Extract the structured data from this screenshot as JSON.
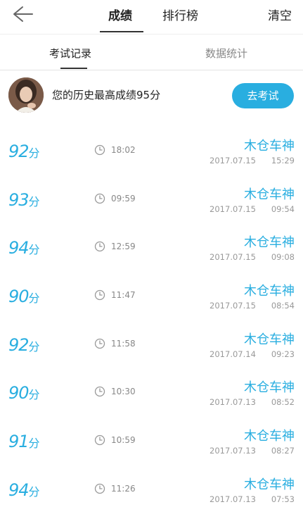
{
  "header": {
    "tabs": [
      {
        "label": "成绩",
        "active": true
      },
      {
        "label": "排行榜",
        "active": false
      }
    ],
    "clear_label": "清空",
    "back_icon": "arrow-left-icon"
  },
  "subtabs": [
    {
      "label": "考试记录",
      "active": true
    },
    {
      "label": "数据统计",
      "active": false
    }
  ],
  "best": {
    "text": "您的历史最高成绩95分",
    "button_label": "去考试"
  },
  "records": [
    {
      "score": "92",
      "unit": "分",
      "time": "18:02",
      "name": "木仓车神",
      "date": "2017.07.15",
      "clock": "15:29"
    },
    {
      "score": "93",
      "unit": "分",
      "time": "09:59",
      "name": "木仓车神",
      "date": "2017.07.15",
      "clock": "09:54"
    },
    {
      "score": "94",
      "unit": "分",
      "time": "12:59",
      "name": "木仓车神",
      "date": "2017.07.15",
      "clock": "09:08"
    },
    {
      "score": "90",
      "unit": "分",
      "time": "11:47",
      "name": "木仓车神",
      "date": "2017.07.15",
      "clock": "08:54"
    },
    {
      "score": "92",
      "unit": "分",
      "time": "11:58",
      "name": "木仓车神",
      "date": "2017.07.14",
      "clock": "09:23"
    },
    {
      "score": "90",
      "unit": "分",
      "time": "10:30",
      "name": "木仓车神",
      "date": "2017.07.13",
      "clock": "08:52"
    },
    {
      "score": "91",
      "unit": "分",
      "time": "10:59",
      "name": "木仓车神",
      "date": "2017.07.13",
      "clock": "08:27"
    },
    {
      "score": "94",
      "unit": "分",
      "time": "11:26",
      "name": "木仓车神",
      "date": "2017.07.13",
      "clock": "07:53"
    }
  ],
  "colors": {
    "accent": "#29aee0"
  }
}
